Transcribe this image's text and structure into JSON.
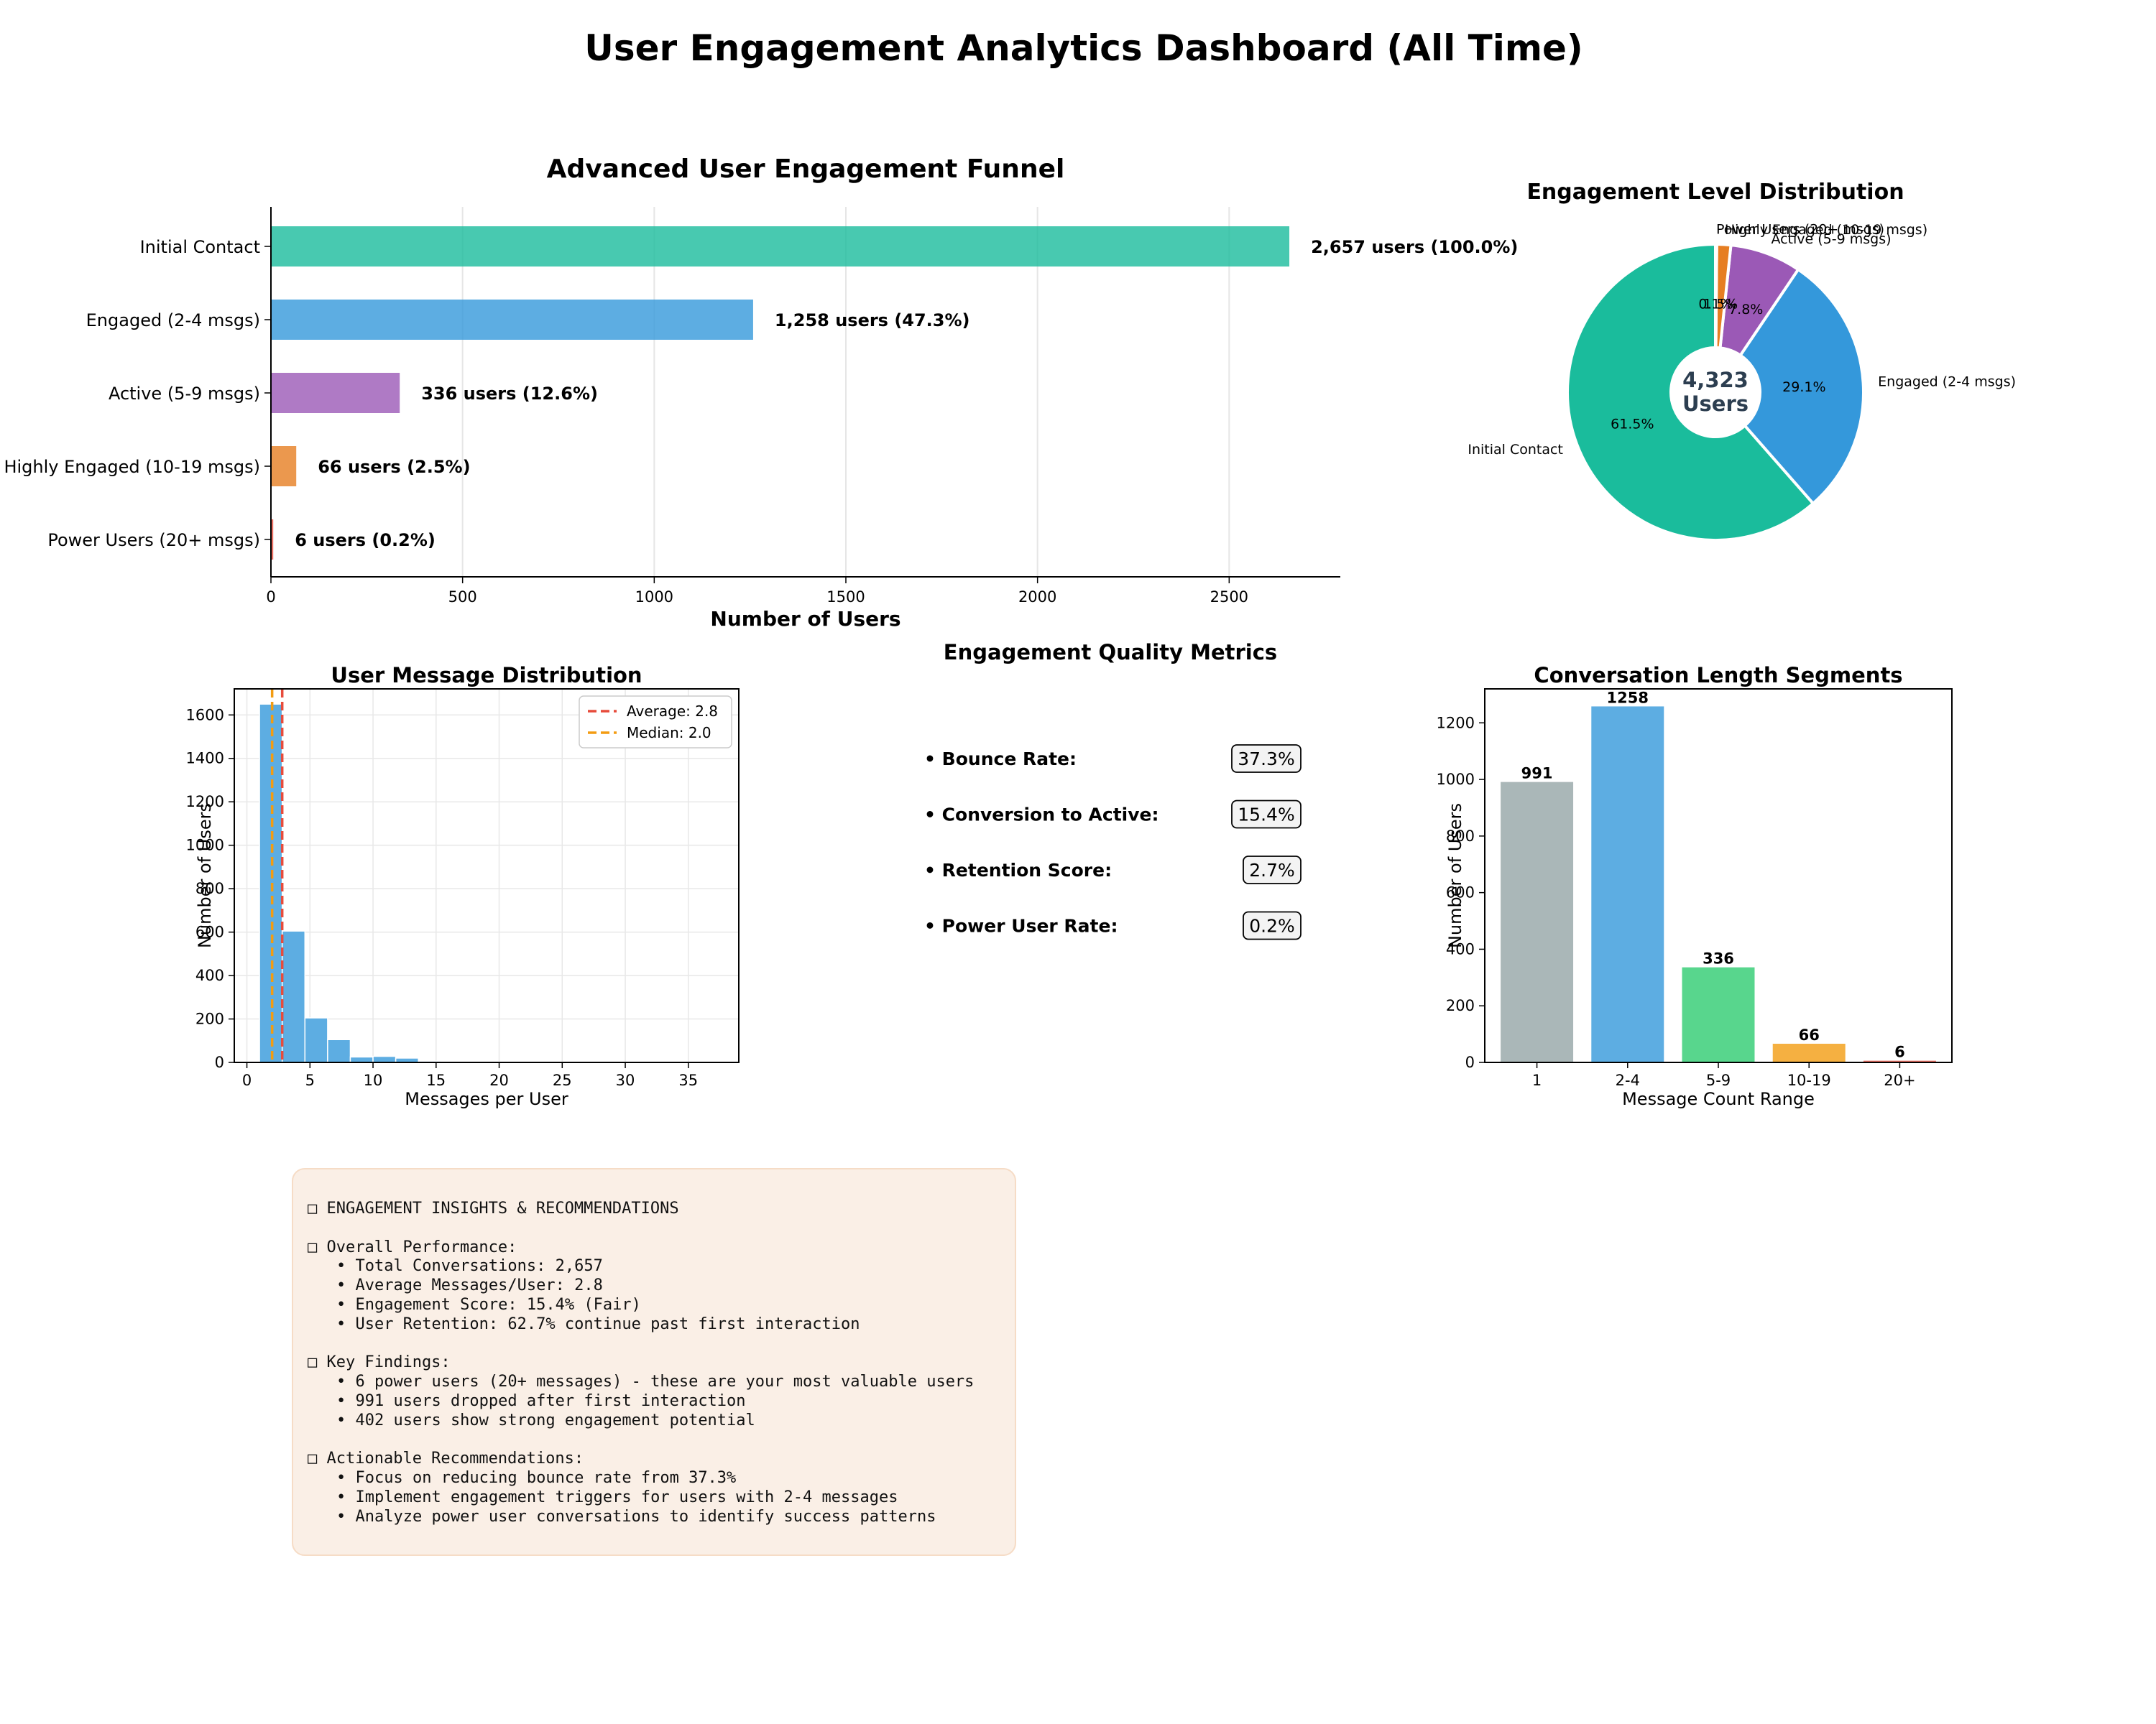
{
  "dashboard_title": "User Engagement Analytics Dashboard (All Time)",
  "colors": {
    "initial": "#1abc9c",
    "engaged": "#3498db",
    "active": "#9b59b6",
    "highly_engaged": "#e67e22",
    "power": "#e74c3c",
    "segment_1": "#95a5a6",
    "segment_5_9": "#2ecc71",
    "segment_10_19": "#f39c12",
    "average_line": "#e74c3c",
    "median_line": "#f39c12",
    "hist_bar": "#5dade2"
  },
  "chart_data": [
    {
      "id": "funnel",
      "type": "bar",
      "orientation": "horizontal",
      "title": "Advanced User Engagement Funnel",
      "xlabel": "Number of Users",
      "categories": [
        "Initial Contact",
        "Engaged (2-4 msgs)",
        "Active (5-9 msgs)",
        "Highly Engaged (10-19 msgs)",
        "Power Users (20+ msgs)"
      ],
      "values": [
        2657,
        1258,
        336,
        66,
        6
      ],
      "data_labels": [
        "2,657 users (100.0%)",
        "1,258 users (47.3%)",
        "336 users (12.6%)",
        "66 users (2.5%)",
        "6 users (0.2%)"
      ],
      "xlim": [
        0,
        2790
      ],
      "xticks": [
        0,
        500,
        1000,
        1500,
        2000,
        2500
      ],
      "grid": "x"
    },
    {
      "id": "pie",
      "type": "pie",
      "title": "Engagement Level Distribution",
      "labels": [
        "Initial Contact",
        "Engaged (2-4 msgs)",
        "Active (5-9 msgs)",
        "Highly Engaged (10-19 msgs)",
        "Power Users (20+ msgs)"
      ],
      "values": [
        2657,
        1258,
        336,
        66,
        6
      ],
      "percent_labels": [
        "61.5%",
        "29.1%",
        "7.8%",
        "1.5%",
        "0.1%"
      ],
      "center_value": "4,323",
      "center_label": "Users",
      "donut": true
    },
    {
      "id": "histogram",
      "type": "bar",
      "subtype": "histogram",
      "title": "User Message Distribution",
      "xlabel": "Messages per User",
      "ylabel": "Number of Users",
      "bin_edges": [
        1,
        2.8,
        4.6,
        6.4,
        8.2,
        10,
        11.8,
        13.6,
        15.4,
        17.2,
        19,
        20.8,
        22.6,
        24.4,
        26.2,
        28,
        29.8,
        31.6,
        33.4,
        35.2
      ],
      "values": [
        1650,
        605,
        205,
        105,
        25,
        28,
        20,
        6,
        4,
        3,
        2,
        2,
        1,
        1,
        1,
        1,
        1,
        1,
        1
      ],
      "xlim": [
        -1,
        39
      ],
      "ylim": [
        0,
        1720
      ],
      "xticks": [
        0,
        5,
        10,
        15,
        20,
        25,
        30,
        35
      ],
      "yticks": [
        0,
        200,
        400,
        600,
        800,
        1000,
        1200,
        1400,
        1600
      ],
      "reference_lines": [
        {
          "name": "Average: 2.8",
          "x": 2.8
        },
        {
          "name": "Median: 2.0",
          "x": 2.0
        }
      ],
      "legend": "top-right",
      "grid": true
    },
    {
      "id": "segments",
      "type": "bar",
      "title": "Conversation Length Segments",
      "xlabel": "Message Count Range",
      "ylabel": "Number of Users",
      "categories": [
        "1",
        "2-4",
        "5-9",
        "10-19",
        "20+"
      ],
      "values": [
        991,
        1258,
        336,
        66,
        6
      ],
      "ylim": [
        0,
        1320
      ],
      "yticks": [
        0,
        200,
        400,
        600,
        800,
        1000,
        1200
      ]
    }
  ],
  "metrics": {
    "title": "Engagement Quality Metrics",
    "items": [
      {
        "label": "• Bounce Rate:",
        "value": "37.3%"
      },
      {
        "label": "• Conversion to Active:",
        "value": "15.4%"
      },
      {
        "label": "• Retention Score:",
        "value": "2.7%"
      },
      {
        "label": "• Power User Rate:",
        "value": "0.2%"
      }
    ]
  },
  "insights": {
    "heading": "□ ENGAGEMENT INSIGHTS & RECOMMENDATIONS",
    "sections": [
      {
        "title": "□ Overall Performance:",
        "bullets": [
          "• Total Conversations: 2,657",
          "• Average Messages/User: 2.8",
          "• Engagement Score: 15.4% (Fair)",
          "• User Retention: 62.7% continue past first interaction"
        ]
      },
      {
        "title": "□ Key Findings:",
        "bullets": [
          "• 6 power users (20+ messages) - these are your most valuable users",
          "• 991 users dropped after first interaction",
          "• 402 users show strong engagement potential"
        ]
      },
      {
        "title": "□ Actionable Recommendations:",
        "bullets": [
          "• Focus on reducing bounce rate from 37.3%",
          "• Implement engagement triggers for users with 2-4 messages",
          "• Analyze power user conversations to identify success patterns"
        ]
      }
    ]
  }
}
